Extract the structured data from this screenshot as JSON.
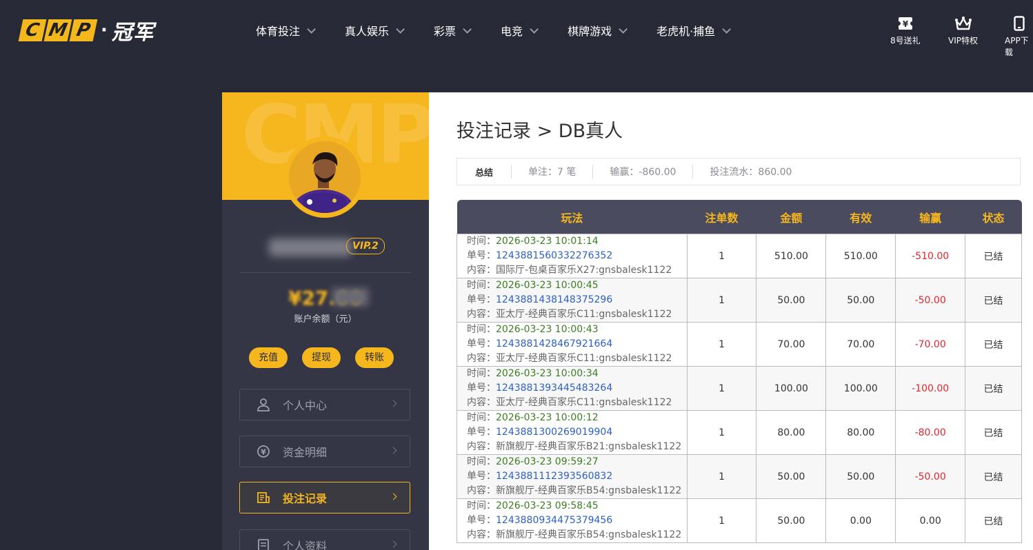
{
  "brand": {
    "logo_letters": [
      "C",
      "M",
      "P"
    ],
    "logo_dot": "·",
    "logo_cn": "冠军"
  },
  "nav": [
    {
      "label": "体育投注"
    },
    {
      "label": "真人娱乐"
    },
    {
      "label": "彩票"
    },
    {
      "label": "电竞"
    },
    {
      "label": "棋牌游戏"
    },
    {
      "label": "老虎机·捕鱼"
    }
  ],
  "quick": [
    {
      "label": "8号送礼",
      "icon": "yen-ticket-icon"
    },
    {
      "label": "VIP特权",
      "icon": "crown-icon"
    },
    {
      "label": "APP下载",
      "icon": "phone-icon"
    }
  ],
  "sidebar": {
    "banner_watermark": "CMP",
    "vip": "VIP.2",
    "balance_label": "账户余额（元）",
    "balance_masked": "¥27.00",
    "actions": [
      "充值",
      "提现",
      "转账"
    ],
    "menu": [
      {
        "label": "个人中心",
        "icon": "user-icon",
        "active": false
      },
      {
        "label": "资金明细",
        "icon": "yen-circle-icon",
        "active": false
      },
      {
        "label": "投注记录",
        "icon": "record-icon",
        "active": true
      },
      {
        "label": "个人资料",
        "icon": "profile-icon",
        "active": false
      }
    ]
  },
  "main": {
    "breadcrumb": "投注记录 > DB真人",
    "summary": {
      "title": "总结",
      "bets": "单注：7 笔",
      "winloss": "输赢：-860.00",
      "turnover": "投注流水：860.00"
    },
    "table": {
      "headers": [
        "玩法",
        "注单数",
        "金额",
        "有效",
        "输赢",
        "状态"
      ],
      "labels": {
        "time": "时间：",
        "order": "单号：",
        "content": "内容："
      },
      "rows": [
        {
          "time": "2026-03-23 10:01:14",
          "order": "1243881560332276352",
          "content": "国际厅-包桌百家乐X27:gnsbalesk1122",
          "count": "1",
          "amount": "510.00",
          "valid": "510.00",
          "winloss": "-510.00",
          "status": "已结"
        },
        {
          "time": "2026-03-23 10:00:45",
          "order": "1243881438148375296",
          "content": "亚太厅-经典百家乐C11:gnsbalesk1122",
          "count": "1",
          "amount": "50.00",
          "valid": "50.00",
          "winloss": "-50.00",
          "status": "已结"
        },
        {
          "time": "2026-03-23 10:00:43",
          "order": "1243881428467921664",
          "content": "亚太厅-经典百家乐C11:gnsbalesk1122",
          "count": "1",
          "amount": "70.00",
          "valid": "70.00",
          "winloss": "-70.00",
          "status": "已结"
        },
        {
          "time": "2026-03-23 10:00:34",
          "order": "1243881393445483264",
          "content": "亚太厅-经典百家乐C11:gnsbalesk1122",
          "count": "1",
          "amount": "100.00",
          "valid": "100.00",
          "winloss": "-100.00",
          "status": "已结"
        },
        {
          "time": "2026-03-23 10:00:12",
          "order": "1243881300269019904",
          "content": "新旗舰厅-经典百家乐B21:gnsbalesk1122",
          "count": "1",
          "amount": "80.00",
          "valid": "80.00",
          "winloss": "-80.00",
          "status": "已结"
        },
        {
          "time": "2026-03-23 09:59:27",
          "order": "1243881112393560832",
          "content": "新旗舰厅-经典百家乐B54:gnsbalesk1122",
          "count": "1",
          "amount": "50.00",
          "valid": "50.00",
          "winloss": "-50.00",
          "status": "已结"
        },
        {
          "time": "2026-03-23 09:58:45",
          "order": "1243880934475379456",
          "content": "新旗舰厅-经典百家乐B54:gnsbalesk1122",
          "count": "1",
          "amount": "50.00",
          "valid": "0.00",
          "winloss": "0.00",
          "status": "已结"
        }
      ]
    }
  },
  "colors": {
    "accent": "#f6b61e",
    "bg": "#282936",
    "negative": "#e0262d",
    "time": "#3a7d23",
    "order": "#2b5fc7"
  }
}
